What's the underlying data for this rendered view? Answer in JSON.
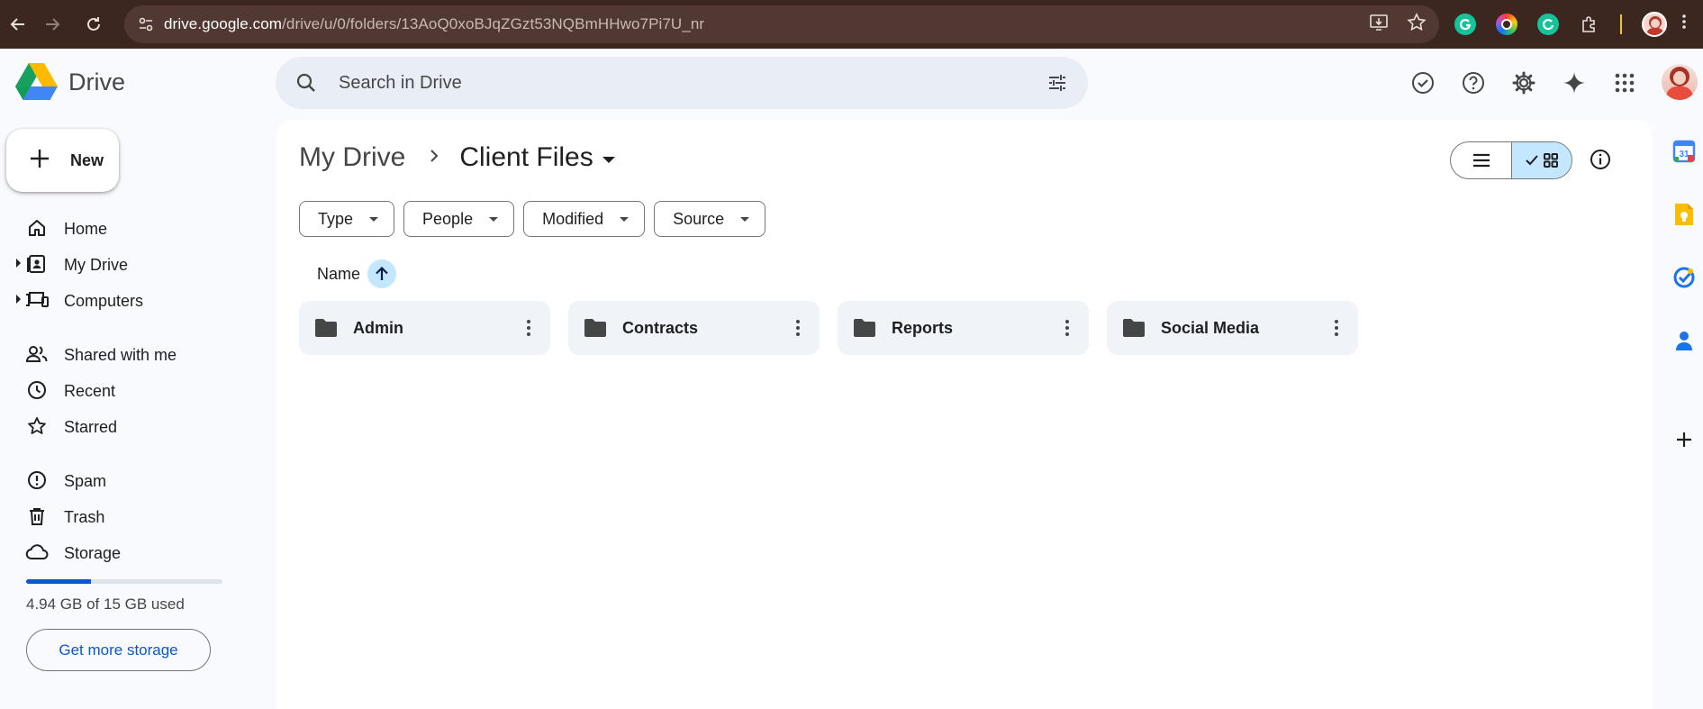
{
  "browser": {
    "url_host": "drive.google.com",
    "url_path": "/drive/u/0/folders/13AoQ0xoBJqZGzt53NQBmHHwo7Pi7U_nr",
    "icons": [
      "back-arrow-icon",
      "forward-arrow-icon",
      "reload-icon",
      "site-settings-icon",
      "install-app-icon",
      "bookmark-star-icon",
      "grammarly-icon",
      "color-picker-icon",
      "grammarly-go-icon",
      "extensions-icon",
      "chrome-menu-icon"
    ]
  },
  "app": {
    "name": "Drive"
  },
  "search": {
    "placeholder": "Search in Drive"
  },
  "header_icons": [
    "ready-for-offline-icon",
    "help-icon",
    "settings-icon",
    "gemini-sparkle-icon",
    "apps-grid-icon"
  ],
  "sidebar": {
    "new_label": "New",
    "items": [
      {
        "label": "Home",
        "icon": "home-icon"
      },
      {
        "label": "My Drive",
        "icon": "my-drive-icon"
      },
      {
        "label": "Computers",
        "icon": "computers-icon"
      },
      {
        "label": "Shared with me",
        "icon": "shared-icon"
      },
      {
        "label": "Recent",
        "icon": "clock-icon"
      },
      {
        "label": "Starred",
        "icon": "star-icon"
      },
      {
        "label": "Spam",
        "icon": "spam-icon"
      },
      {
        "label": "Trash",
        "icon": "trash-icon"
      },
      {
        "label": "Storage",
        "icon": "cloud-icon"
      }
    ],
    "storage_used_fraction": 0.33,
    "storage_text": "4.94 GB of 15 GB used",
    "get_more_storage": "Get more storage"
  },
  "main": {
    "breadcrumb_root": "My Drive",
    "breadcrumb_current": "Client Files",
    "filters": [
      "Type",
      "People",
      "Modified",
      "Source"
    ],
    "sort_label": "Name",
    "folders": [
      {
        "name": "Admin"
      },
      {
        "name": "Contracts"
      },
      {
        "name": "Reports"
      },
      {
        "name": "Social Media"
      }
    ]
  },
  "side_panel_icons": [
    "calendar-icon",
    "keep-icon",
    "tasks-icon",
    "contacts-icon",
    "add-addon-icon"
  ],
  "calendar_day": "31",
  "colors": {
    "accent": "#0b57d0",
    "selected": "#c2e7ff",
    "chrome_bg": "#3c2620",
    "page_bg": "#f8fafd"
  }
}
